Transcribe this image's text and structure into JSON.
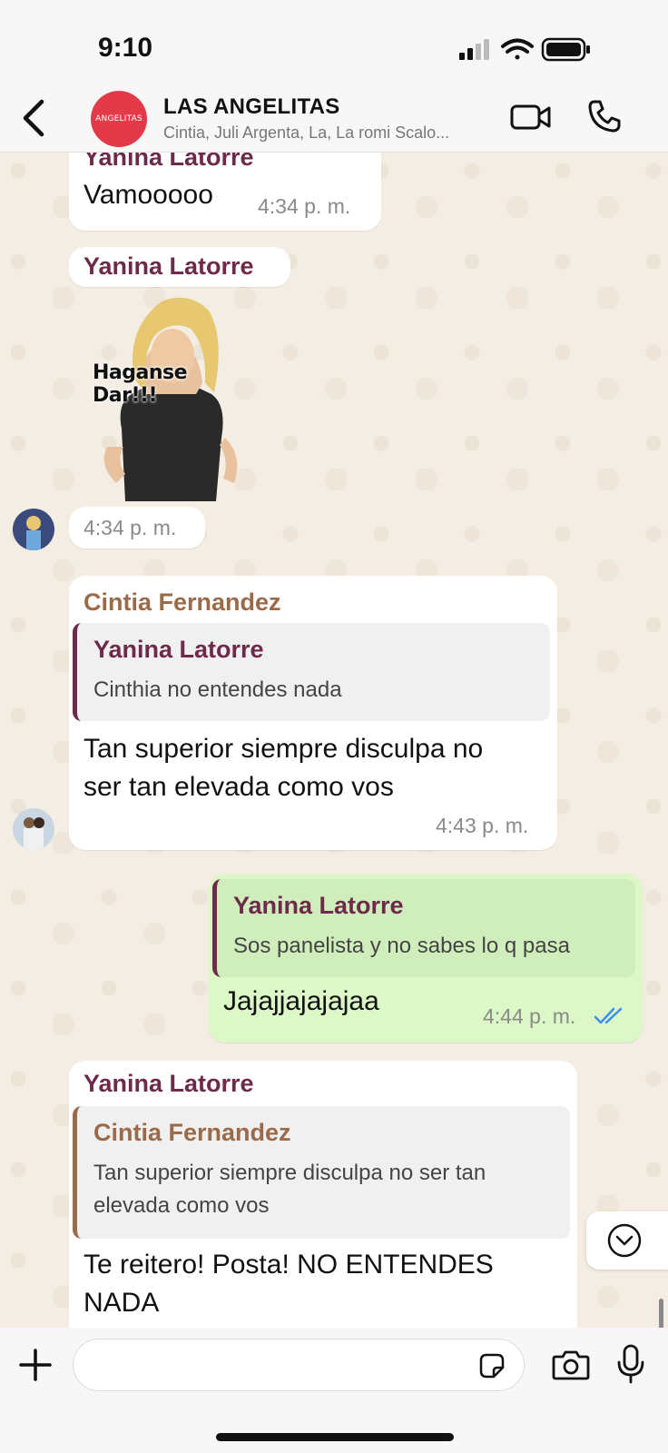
{
  "status_bar": {
    "time": "9:10"
  },
  "header": {
    "avatar_text": "ANGELITAS",
    "title": "LAS ANGELITAS",
    "members": "Cintia, Juli Argenta, La, La romi Scalo..."
  },
  "colors": {
    "yanina": "#6e2a4a",
    "cintia": "#9a6b4a",
    "read_ticks": "#3b8ff0",
    "outgoing_bubble": "#dcf8c6",
    "group_avatar": "#e23a48"
  },
  "messages": {
    "m1": {
      "sender": "Yanina Latorre",
      "text": "Vamooooo",
      "time": "4:34 p. m."
    },
    "m2": {
      "sender": "Yanina Latorre",
      "sticker_caption": "Haganse Dar!!!",
      "time": "4:34 p. m."
    },
    "m3": {
      "sender": "Cintia Fernandez",
      "quote_sender": "Yanina Latorre",
      "quote_text": "Cinthia no entendes nada",
      "text_line1": "Tan superior siempre disculpa no",
      "text_line2": "ser tan elevada como vos",
      "time": "4:43 p. m."
    },
    "m4": {
      "quote_sender": "Yanina Latorre",
      "quote_text": "Sos panelista y no sabes lo q pasa",
      "text": "Jajajjajajajaa",
      "time": "4:44 p. m."
    },
    "m5": {
      "sender": "Yanina Latorre",
      "quote_sender": "Cintia Fernandez",
      "quote_text_line1": "Tan superior siempre disculpa no ser tan",
      "quote_text_line2": "elevada como vos",
      "text_line1": "Te reitero! Posta! NO ENTENDES",
      "text_line2": "NADA"
    }
  },
  "input": {
    "placeholder": ""
  }
}
